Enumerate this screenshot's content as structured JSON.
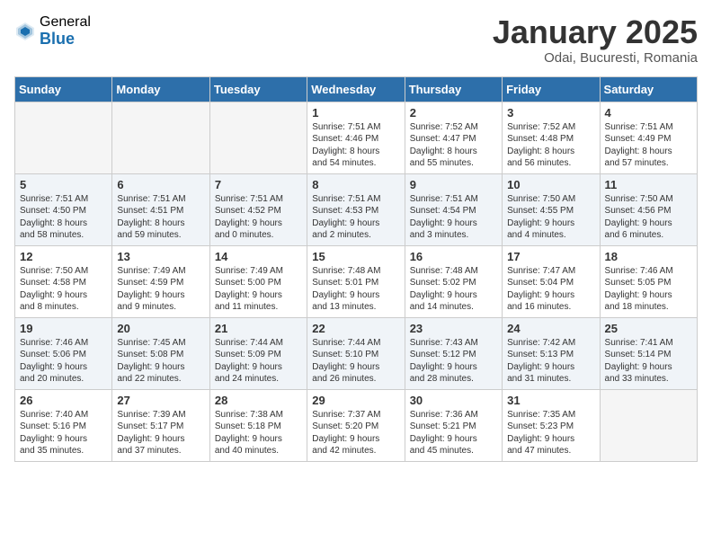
{
  "logo": {
    "general": "General",
    "blue": "Blue"
  },
  "header": {
    "title": "January 2025",
    "location": "Odai, Bucuresti, Romania"
  },
  "weekdays": [
    "Sunday",
    "Monday",
    "Tuesday",
    "Wednesday",
    "Thursday",
    "Friday",
    "Saturday"
  ],
  "weeks": [
    {
      "days": [
        {
          "num": "",
          "info": ""
        },
        {
          "num": "",
          "info": ""
        },
        {
          "num": "",
          "info": ""
        },
        {
          "num": "1",
          "info": "Sunrise: 7:51 AM\nSunset: 4:46 PM\nDaylight: 8 hours\nand 54 minutes."
        },
        {
          "num": "2",
          "info": "Sunrise: 7:52 AM\nSunset: 4:47 PM\nDaylight: 8 hours\nand 55 minutes."
        },
        {
          "num": "3",
          "info": "Sunrise: 7:52 AM\nSunset: 4:48 PM\nDaylight: 8 hours\nand 56 minutes."
        },
        {
          "num": "4",
          "info": "Sunrise: 7:51 AM\nSunset: 4:49 PM\nDaylight: 8 hours\nand 57 minutes."
        }
      ]
    },
    {
      "days": [
        {
          "num": "5",
          "info": "Sunrise: 7:51 AM\nSunset: 4:50 PM\nDaylight: 8 hours\nand 58 minutes."
        },
        {
          "num": "6",
          "info": "Sunrise: 7:51 AM\nSunset: 4:51 PM\nDaylight: 8 hours\nand 59 minutes."
        },
        {
          "num": "7",
          "info": "Sunrise: 7:51 AM\nSunset: 4:52 PM\nDaylight: 9 hours\nand 0 minutes."
        },
        {
          "num": "8",
          "info": "Sunrise: 7:51 AM\nSunset: 4:53 PM\nDaylight: 9 hours\nand 2 minutes."
        },
        {
          "num": "9",
          "info": "Sunrise: 7:51 AM\nSunset: 4:54 PM\nDaylight: 9 hours\nand 3 minutes."
        },
        {
          "num": "10",
          "info": "Sunrise: 7:50 AM\nSunset: 4:55 PM\nDaylight: 9 hours\nand 4 minutes."
        },
        {
          "num": "11",
          "info": "Sunrise: 7:50 AM\nSunset: 4:56 PM\nDaylight: 9 hours\nand 6 minutes."
        }
      ]
    },
    {
      "days": [
        {
          "num": "12",
          "info": "Sunrise: 7:50 AM\nSunset: 4:58 PM\nDaylight: 9 hours\nand 8 minutes."
        },
        {
          "num": "13",
          "info": "Sunrise: 7:49 AM\nSunset: 4:59 PM\nDaylight: 9 hours\nand 9 minutes."
        },
        {
          "num": "14",
          "info": "Sunrise: 7:49 AM\nSunset: 5:00 PM\nDaylight: 9 hours\nand 11 minutes."
        },
        {
          "num": "15",
          "info": "Sunrise: 7:48 AM\nSunset: 5:01 PM\nDaylight: 9 hours\nand 13 minutes."
        },
        {
          "num": "16",
          "info": "Sunrise: 7:48 AM\nSunset: 5:02 PM\nDaylight: 9 hours\nand 14 minutes."
        },
        {
          "num": "17",
          "info": "Sunrise: 7:47 AM\nSunset: 5:04 PM\nDaylight: 9 hours\nand 16 minutes."
        },
        {
          "num": "18",
          "info": "Sunrise: 7:46 AM\nSunset: 5:05 PM\nDaylight: 9 hours\nand 18 minutes."
        }
      ]
    },
    {
      "days": [
        {
          "num": "19",
          "info": "Sunrise: 7:46 AM\nSunset: 5:06 PM\nDaylight: 9 hours\nand 20 minutes."
        },
        {
          "num": "20",
          "info": "Sunrise: 7:45 AM\nSunset: 5:08 PM\nDaylight: 9 hours\nand 22 minutes."
        },
        {
          "num": "21",
          "info": "Sunrise: 7:44 AM\nSunset: 5:09 PM\nDaylight: 9 hours\nand 24 minutes."
        },
        {
          "num": "22",
          "info": "Sunrise: 7:44 AM\nSunset: 5:10 PM\nDaylight: 9 hours\nand 26 minutes."
        },
        {
          "num": "23",
          "info": "Sunrise: 7:43 AM\nSunset: 5:12 PM\nDaylight: 9 hours\nand 28 minutes."
        },
        {
          "num": "24",
          "info": "Sunrise: 7:42 AM\nSunset: 5:13 PM\nDaylight: 9 hours\nand 31 minutes."
        },
        {
          "num": "25",
          "info": "Sunrise: 7:41 AM\nSunset: 5:14 PM\nDaylight: 9 hours\nand 33 minutes."
        }
      ]
    },
    {
      "days": [
        {
          "num": "26",
          "info": "Sunrise: 7:40 AM\nSunset: 5:16 PM\nDaylight: 9 hours\nand 35 minutes."
        },
        {
          "num": "27",
          "info": "Sunrise: 7:39 AM\nSunset: 5:17 PM\nDaylight: 9 hours\nand 37 minutes."
        },
        {
          "num": "28",
          "info": "Sunrise: 7:38 AM\nSunset: 5:18 PM\nDaylight: 9 hours\nand 40 minutes."
        },
        {
          "num": "29",
          "info": "Sunrise: 7:37 AM\nSunset: 5:20 PM\nDaylight: 9 hours\nand 42 minutes."
        },
        {
          "num": "30",
          "info": "Sunrise: 7:36 AM\nSunset: 5:21 PM\nDaylight: 9 hours\nand 45 minutes."
        },
        {
          "num": "31",
          "info": "Sunrise: 7:35 AM\nSunset: 5:23 PM\nDaylight: 9 hours\nand 47 minutes."
        },
        {
          "num": "",
          "info": ""
        }
      ]
    }
  ]
}
